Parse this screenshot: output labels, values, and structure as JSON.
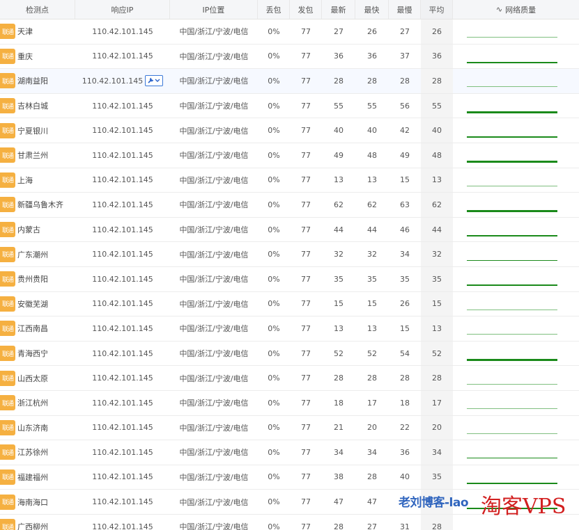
{
  "header": {
    "node": "检测点",
    "ip": "响应IP",
    "location": "IP位置",
    "loss": "丢包",
    "sent": "发包",
    "last": "最新",
    "best": "最快",
    "worst": "最慢",
    "avg": "平均",
    "quality": "网络质量",
    "quality_icon": "pulse-icon"
  },
  "isp_badge": "联通",
  "tool_icon": "wrench-dropdown-icon",
  "colors": {
    "badge": "#f5b041",
    "line_light": "#7fbf7f",
    "line_dark": "#1a8a1a"
  },
  "rows": [
    {
      "node": "天津",
      "ip": "110.42.101.145",
      "loc": "中国/浙江/宁波/电信",
      "loss": "0%",
      "sent": "77",
      "last": "27",
      "best": "26",
      "worst": "27",
      "avg": "26"
    },
    {
      "node": "重庆",
      "ip": "110.42.101.145",
      "loc": "中国/浙江/宁波/电信",
      "loss": "0%",
      "sent": "77",
      "last": "36",
      "best": "36",
      "worst": "37",
      "avg": "36"
    },
    {
      "node": "湖南益阳",
      "ip": "110.42.101.145",
      "loc": "中国/浙江/宁波/电信",
      "loss": "0%",
      "sent": "77",
      "last": "28",
      "best": "28",
      "worst": "28",
      "avg": "28",
      "tool": true
    },
    {
      "node": "吉林白城",
      "ip": "110.42.101.145",
      "loc": "中国/浙江/宁波/电信",
      "loss": "0%",
      "sent": "77",
      "last": "55",
      "best": "55",
      "worst": "56",
      "avg": "55"
    },
    {
      "node": "宁夏银川",
      "ip": "110.42.101.145",
      "loc": "中国/浙江/宁波/电信",
      "loss": "0%",
      "sent": "77",
      "last": "40",
      "best": "40",
      "worst": "42",
      "avg": "40"
    },
    {
      "node": "甘肃兰州",
      "ip": "110.42.101.145",
      "loc": "中国/浙江/宁波/电信",
      "loss": "0%",
      "sent": "77",
      "last": "49",
      "best": "48",
      "worst": "49",
      "avg": "48"
    },
    {
      "node": "上海",
      "ip": "110.42.101.145",
      "loc": "中国/浙江/宁波/电信",
      "loss": "0%",
      "sent": "77",
      "last": "13",
      "best": "13",
      "worst": "15",
      "avg": "13"
    },
    {
      "node": "新疆乌鲁木齐",
      "ip": "110.42.101.145",
      "loc": "中国/浙江/宁波/电信",
      "loss": "0%",
      "sent": "77",
      "last": "62",
      "best": "62",
      "worst": "63",
      "avg": "62"
    },
    {
      "node": "内蒙古",
      "ip": "110.42.101.145",
      "loc": "中国/浙江/宁波/电信",
      "loss": "0%",
      "sent": "77",
      "last": "44",
      "best": "44",
      "worst": "46",
      "avg": "44"
    },
    {
      "node": "广东潮州",
      "ip": "110.42.101.145",
      "loc": "中国/浙江/宁波/电信",
      "loss": "0%",
      "sent": "77",
      "last": "32",
      "best": "32",
      "worst": "34",
      "avg": "32"
    },
    {
      "node": "贵州贵阳",
      "ip": "110.42.101.145",
      "loc": "中国/浙江/宁波/电信",
      "loss": "0%",
      "sent": "77",
      "last": "35",
      "best": "35",
      "worst": "35",
      "avg": "35"
    },
    {
      "node": "安徽芜湖",
      "ip": "110.42.101.145",
      "loc": "中国/浙江/宁波/电信",
      "loss": "0%",
      "sent": "77",
      "last": "15",
      "best": "15",
      "worst": "26",
      "avg": "15"
    },
    {
      "node": "江西南昌",
      "ip": "110.42.101.145",
      "loc": "中国/浙江/宁波/电信",
      "loss": "0%",
      "sent": "77",
      "last": "13",
      "best": "13",
      "worst": "15",
      "avg": "13"
    },
    {
      "node": "青海西宁",
      "ip": "110.42.101.145",
      "loc": "中国/浙江/宁波/电信",
      "loss": "0%",
      "sent": "77",
      "last": "52",
      "best": "52",
      "worst": "54",
      "avg": "52"
    },
    {
      "node": "山西太原",
      "ip": "110.42.101.145",
      "loc": "中国/浙江/宁波/电信",
      "loss": "0%",
      "sent": "77",
      "last": "28",
      "best": "28",
      "worst": "28",
      "avg": "28"
    },
    {
      "node": "浙江杭州",
      "ip": "110.42.101.145",
      "loc": "中国/浙江/宁波/电信",
      "loss": "0%",
      "sent": "77",
      "last": "18",
      "best": "17",
      "worst": "18",
      "avg": "17"
    },
    {
      "node": "山东济南",
      "ip": "110.42.101.145",
      "loc": "中国/浙江/宁波/电信",
      "loss": "0%",
      "sent": "77",
      "last": "21",
      "best": "20",
      "worst": "22",
      "avg": "20"
    },
    {
      "node": "江苏徐州",
      "ip": "110.42.101.145",
      "loc": "中国/浙江/宁波/电信",
      "loss": "0%",
      "sent": "77",
      "last": "34",
      "best": "34",
      "worst": "36",
      "avg": "34"
    },
    {
      "node": "福建福州",
      "ip": "110.42.101.145",
      "loc": "中国/浙江/宁波/电信",
      "loss": "0%",
      "sent": "77",
      "last": "38",
      "best": "28",
      "worst": "40",
      "avg": "35"
    },
    {
      "node": "海南海口",
      "ip": "110.42.101.145",
      "loc": "中国/浙江/宁波/电信",
      "loss": "0%",
      "sent": "77",
      "last": "47",
      "best": "47",
      "worst": "",
      "avg": ""
    },
    {
      "node": "广西柳州",
      "ip": "110.42.101.145",
      "loc": "中国/浙江/宁波/电信",
      "loss": "0%",
      "sent": "77",
      "last": "28",
      "best": "27",
      "worst": "31",
      "avg": "28"
    }
  ],
  "watermark": {
    "blog": "老刘博客-lao",
    "vps": "淘客VPS"
  }
}
